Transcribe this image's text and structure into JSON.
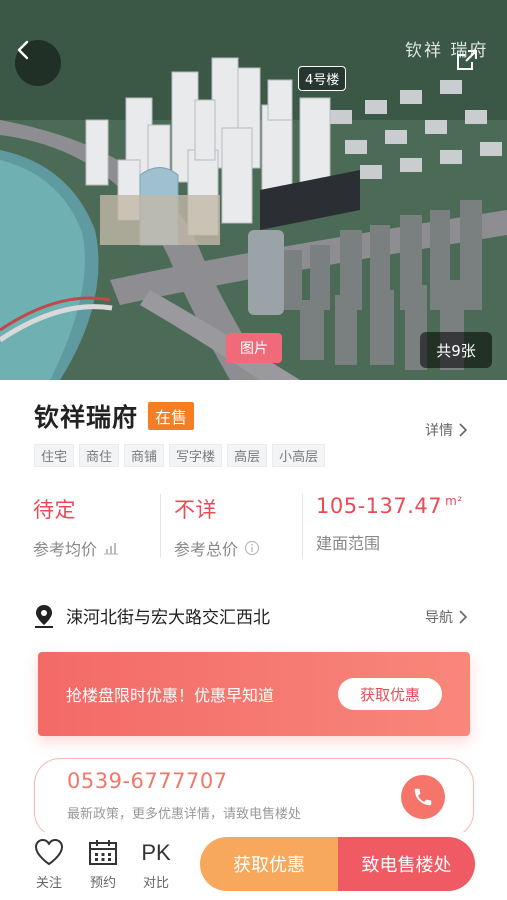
{
  "hero": {
    "watermark": "钦祥 瑞府",
    "building_tag": "4号楼",
    "photo_tab": "图片",
    "photo_count": "共9张"
  },
  "project": {
    "name": "钦祥瑞府",
    "status": "在售",
    "detail_link": "详情",
    "tags": [
      "住宅",
      "商住",
      "商铺",
      "写字楼",
      "高层",
      "小高层"
    ]
  },
  "stats": [
    {
      "value": "待定",
      "label": "参考均价",
      "icon": "chart-icon"
    },
    {
      "value": "不详",
      "label": "参考总价",
      "icon": "info-icon"
    },
    {
      "value": "105-137.47",
      "unit": "m²",
      "label": "建面范围"
    }
  ],
  "address": {
    "text": "涑河北街与宏大路交汇西北",
    "nav_link": "导航"
  },
  "promo": {
    "text": "抢楼盘限时优惠！优惠早知道",
    "button": "获取优惠"
  },
  "phone": {
    "number": "0539-6777707",
    "subtitle": "最新政策，更多优惠详情，请致电售楼处"
  },
  "bottom_bar": {
    "follow": "关注",
    "appointment": "预约",
    "pk": "PK",
    "compare": "对比",
    "get_discount": "获取优惠",
    "call_sales": "致电售楼处"
  },
  "colors": {
    "accent_red": "#ed4a56",
    "badge_orange": "#f47e24",
    "cta_orange": "#f8a85d",
    "cta_red": "#ef5a63"
  }
}
